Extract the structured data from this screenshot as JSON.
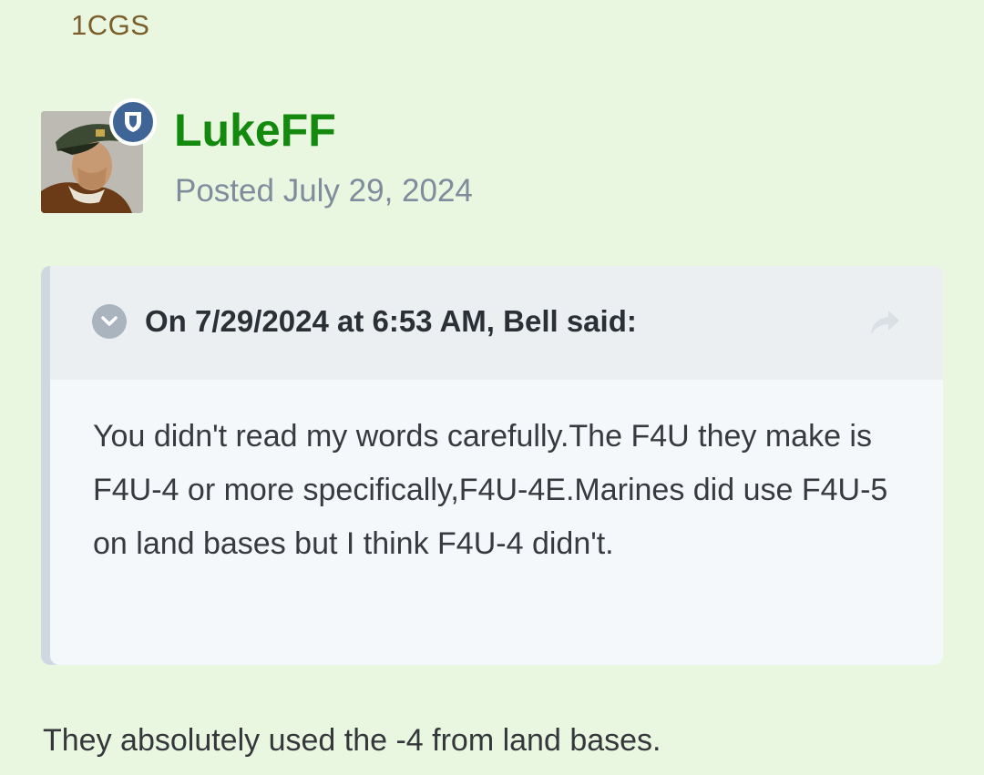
{
  "forum": {
    "title": "1CGS"
  },
  "post": {
    "author": "LukeFF",
    "date": "Posted July 29, 2024",
    "author_badge_icon": "shield-icon",
    "avatar_icon": "user-avatar-pilot"
  },
  "quote": {
    "citation": "On 7/29/2024 at 6:53 AM, Bell said:",
    "collapse_icon": "chevron-down-icon",
    "share_icon": "share-arrow-icon",
    "body": "You didn't read my words carefully.The F4U they make is F4U-4 or more specifically,F4U-4E.Marines did use F4U-5 on land bases but I think F4U-4 didn't."
  },
  "reply": {
    "text": "They absolutely used the -4 from land bases."
  },
  "colors": {
    "background": "#e9f6e0",
    "author_name": "#138a0e",
    "forum_title": "#7a5f2d",
    "badge": "#3f6496",
    "quote_header": "#ebeff2",
    "quote_body": "#f4f8fa"
  }
}
